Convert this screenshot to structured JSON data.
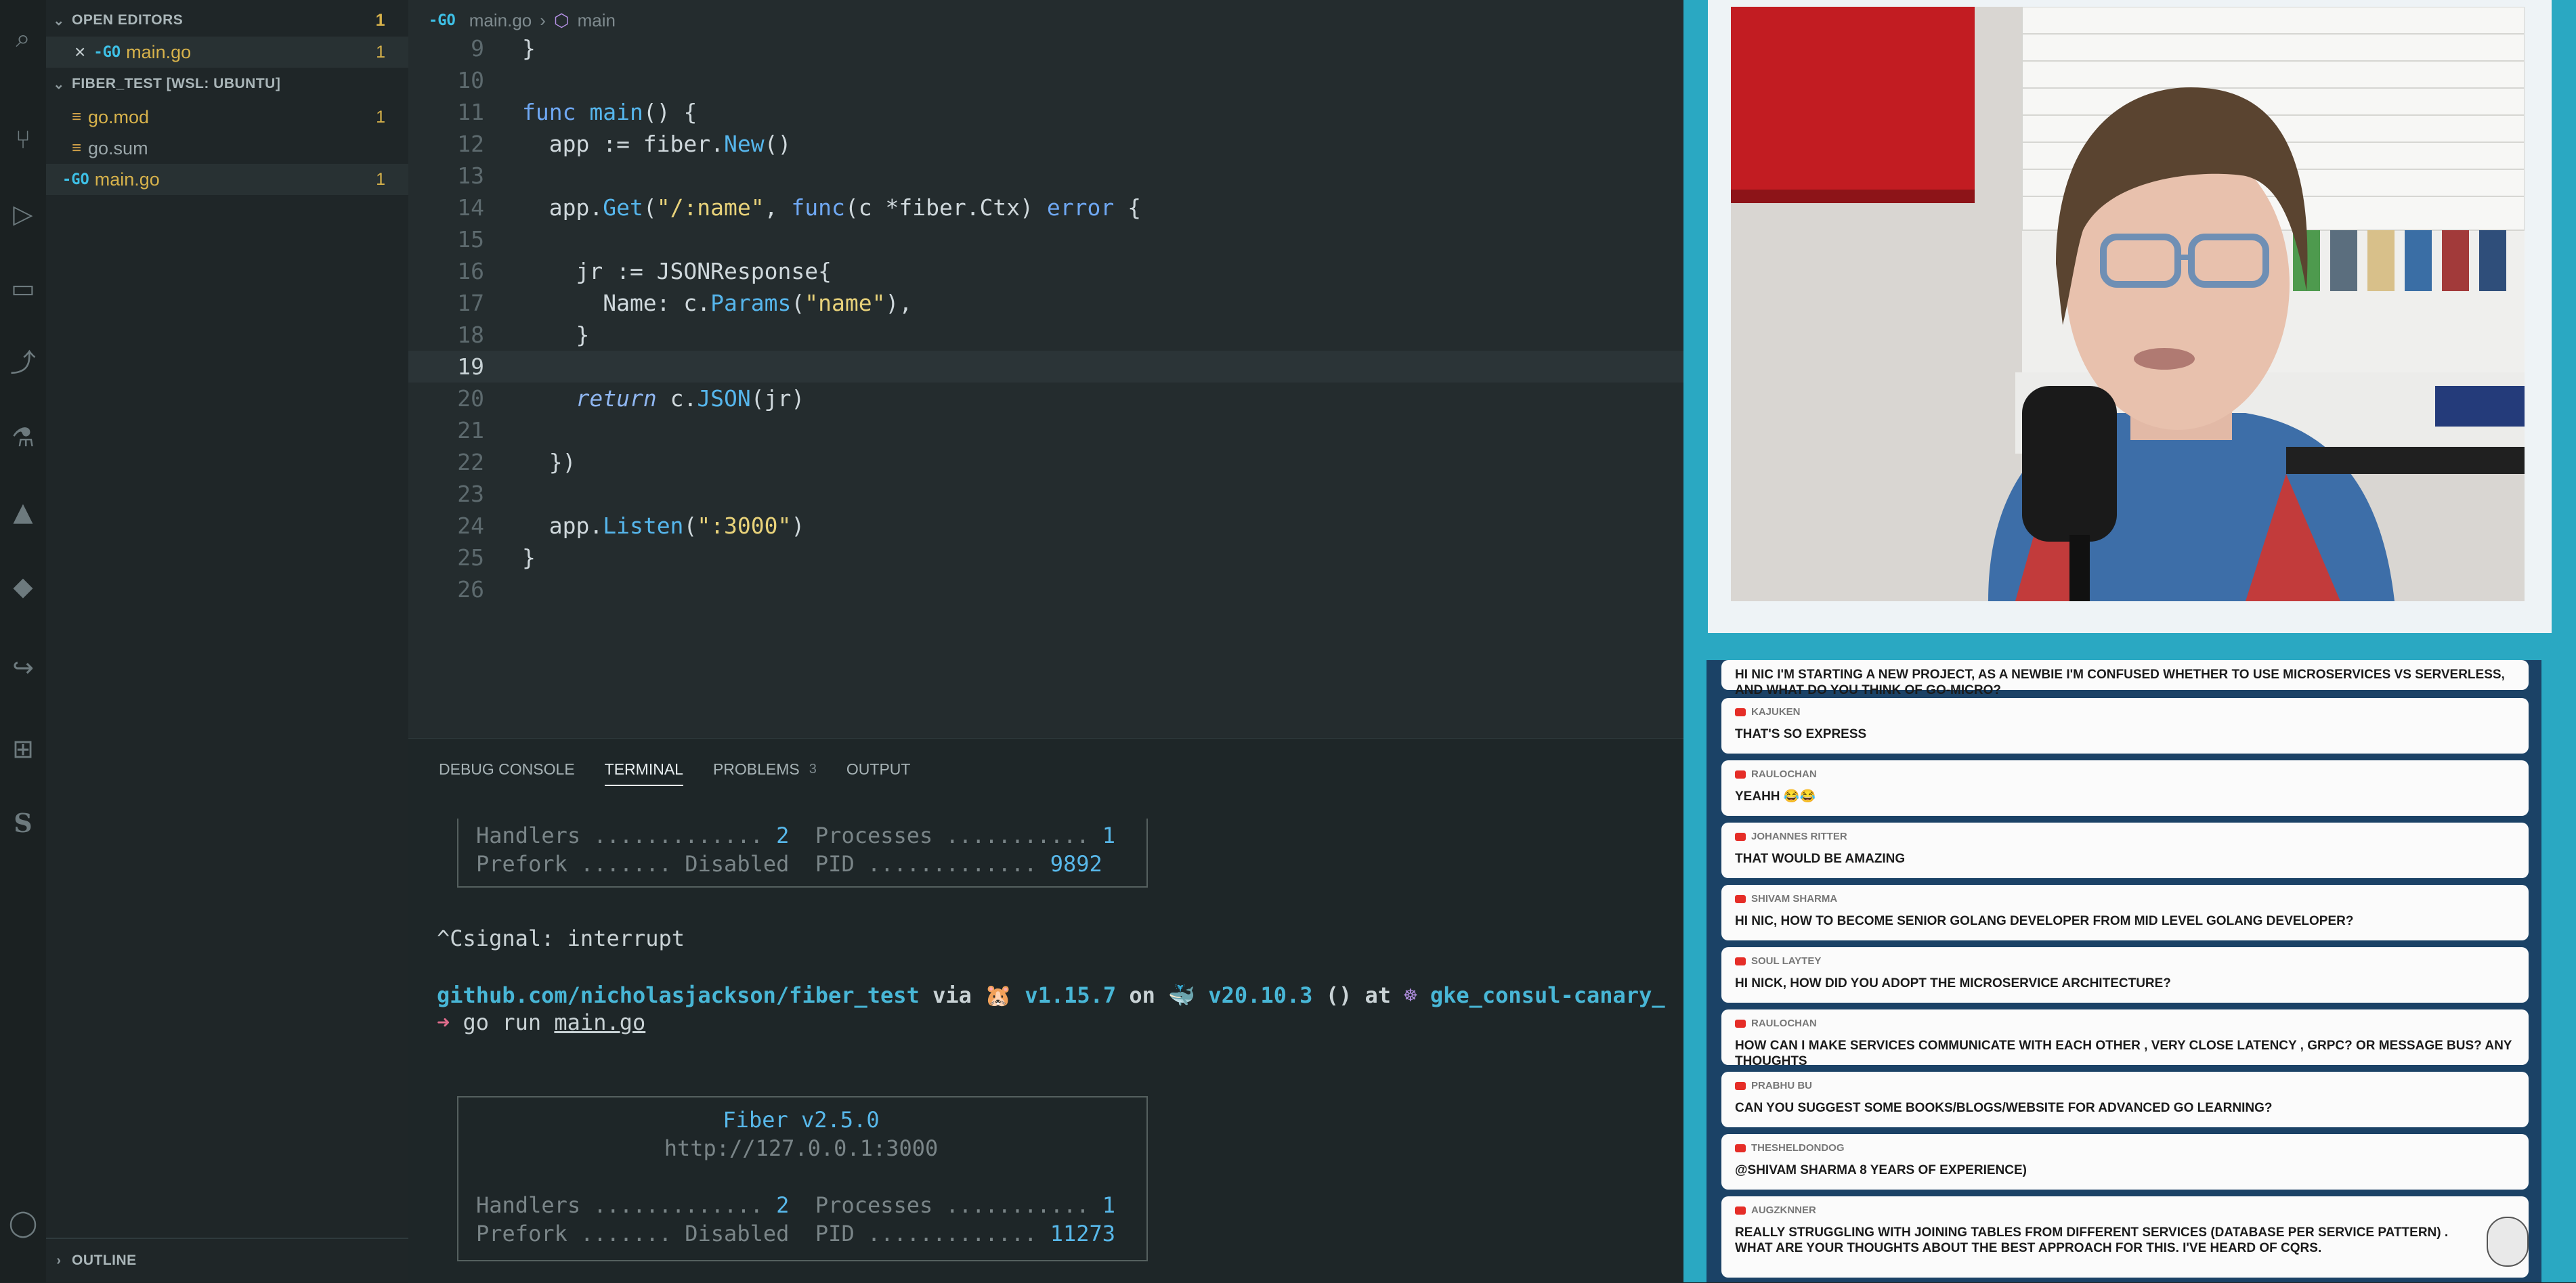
{
  "activity_bar": {
    "icons": [
      "explorer-icon",
      "search-icon",
      "source-control-icon",
      "run-debug-icon",
      "remote-explorer-icon",
      "git-pull-request-icon",
      "test-flask-icon",
      "azure-icon",
      "docker-icon",
      "live-share-icon",
      "extensions-icon",
      "s-icon",
      "account-icon"
    ]
  },
  "sidebar": {
    "open_editors": {
      "title": "OPEN EDITORS",
      "badge": "1",
      "files": [
        {
          "close": "×",
          "icon": "go-icon",
          "name": "main.go",
          "badge": "1"
        }
      ]
    },
    "project": {
      "title": "FIBER_TEST [WSL: UBUNTU]",
      "files": [
        {
          "icon": "go-mod-icon",
          "name": "go.mod",
          "badge": "1"
        },
        {
          "icon": "go-mod-icon",
          "name": "go.sum",
          "badge": ""
        },
        {
          "icon": "go-icon",
          "name": "main.go",
          "badge": "1"
        }
      ]
    },
    "outline": {
      "title": "OUTLINE"
    }
  },
  "editor": {
    "breadcrumb": {
      "file": "main.go",
      "symbol": "main"
    },
    "current_line": "19",
    "lines": [
      {
        "n": "9"
      },
      {
        "n": "10"
      },
      {
        "n": "11"
      },
      {
        "n": "12"
      },
      {
        "n": "13"
      },
      {
        "n": "14"
      },
      {
        "n": "15"
      },
      {
        "n": "16"
      },
      {
        "n": "17"
      },
      {
        "n": "18"
      },
      {
        "n": "19"
      },
      {
        "n": "20"
      },
      {
        "n": "21"
      },
      {
        "n": "22"
      },
      {
        "n": "23"
      },
      {
        "n": "24"
      },
      {
        "n": "25"
      },
      {
        "n": "26"
      }
    ]
  },
  "panel": {
    "tabs": [
      {
        "label": "DEBUG CONSOLE"
      },
      {
        "label": "TERMINAL"
      },
      {
        "label": "PROBLEMS",
        "count": "3"
      },
      {
        "label": "OUTPUT"
      }
    ],
    "terminal": {
      "box1": {
        "handlers_label": "Handlers ............. ",
        "handlers": "2",
        "processes_label": "  Processes ........... ",
        "processes": "1",
        "prefork_label": "Prefork ....... Disabled  PID ............. ",
        "pid": "9892"
      },
      "interrupt": "^Csignal: interrupt",
      "prompt": {
        "path": "github.com/nicholasjackson/fiber_test",
        "via": " via ",
        "go_icon": "🐹",
        "go_version": " v1.15.7",
        "on": " on ",
        "docker_icon": "🐳",
        "docker_version": " v20.10.3",
        "ctx": " () at ",
        "k8s_icon": "☸",
        "k8s_context": " gke_consul-canary_"
      },
      "command": {
        "arrow": "➜",
        "cmd": " go run ",
        "arg": "main.go"
      },
      "box2": {
        "title": "Fiber v2.5.0",
        "url": "http://127.0.0.1:3000",
        "handlers_label": "Handlers ............. ",
        "handlers": "2",
        "processes_label": "  Processes ........... ",
        "processes": "1",
        "prefork_label": "Prefork ....... Disabled  PID ............. ",
        "pid": "11273"
      }
    }
  },
  "chat": {
    "messages": [
      {
        "author": "",
        "text": "HI NIC I'M STARTING A NEW PROJECT, AS A NEWBIE I'M CONFUSED WHETHER TO USE MICROSERVICES VS SERVERLESS, AND WHAT DO YOU THINK OF GO-MICRO?"
      },
      {
        "author": "KAJUKEN",
        "text": "THAT'S SO EXPRESS"
      },
      {
        "author": "RAULOCHAN",
        "text": "YEAHH 😂😂"
      },
      {
        "author": "JOHANNES RITTER",
        "text": "THAT WOULD BE AMAZING"
      },
      {
        "author": "SHIVAM SHARMA",
        "text": "HI NIC, HOW TO BECOME SENIOR GOLANG DEVELOPER FROM MID LEVEL GOLANG DEVELOPER?"
      },
      {
        "author": "SOUL LAYTEY",
        "text": "HI NICK, HOW DID YOU ADOPT THE MICROSERVICE ARCHITECTURE?"
      },
      {
        "author": "RAULOCHAN",
        "text": "HOW CAN I MAKE SERVICES COMMUNICATE WITH EACH OTHER , VERY CLOSE LATENCY , GRPC? OR MESSAGE BUS? ANY THOUGHTS"
      },
      {
        "author": "PRABHU BU",
        "text": "CAN YOU SUGGEST SOME BOOKS/BLOGS/WEBSITE FOR ADVANCED GO LEARNING?"
      },
      {
        "author": "THESHELDONDOG",
        "text": "@SHIVAM SHARMA 8 YEARS OF EXPERIENCE)"
      },
      {
        "author": "AUGZKNNER",
        "text": "REALLY STRUGGLING WITH JOINING TABLES FROM DIFFERENT SERVICES (DATABASE PER SERVICE PATTERN) . WHAT ARE YOUR THOUGHTS ABOUT THE BEST APPROACH FOR THIS. I'VE HEARD OF CQRS."
      }
    ]
  },
  "colors": {
    "overlay_accent": "#2aa8c2",
    "chat_bg": "#1b4266",
    "go_blue": "#3ec0e6",
    "badge_yellow": "#d7b24b",
    "editor_bg": "#242c2e"
  }
}
